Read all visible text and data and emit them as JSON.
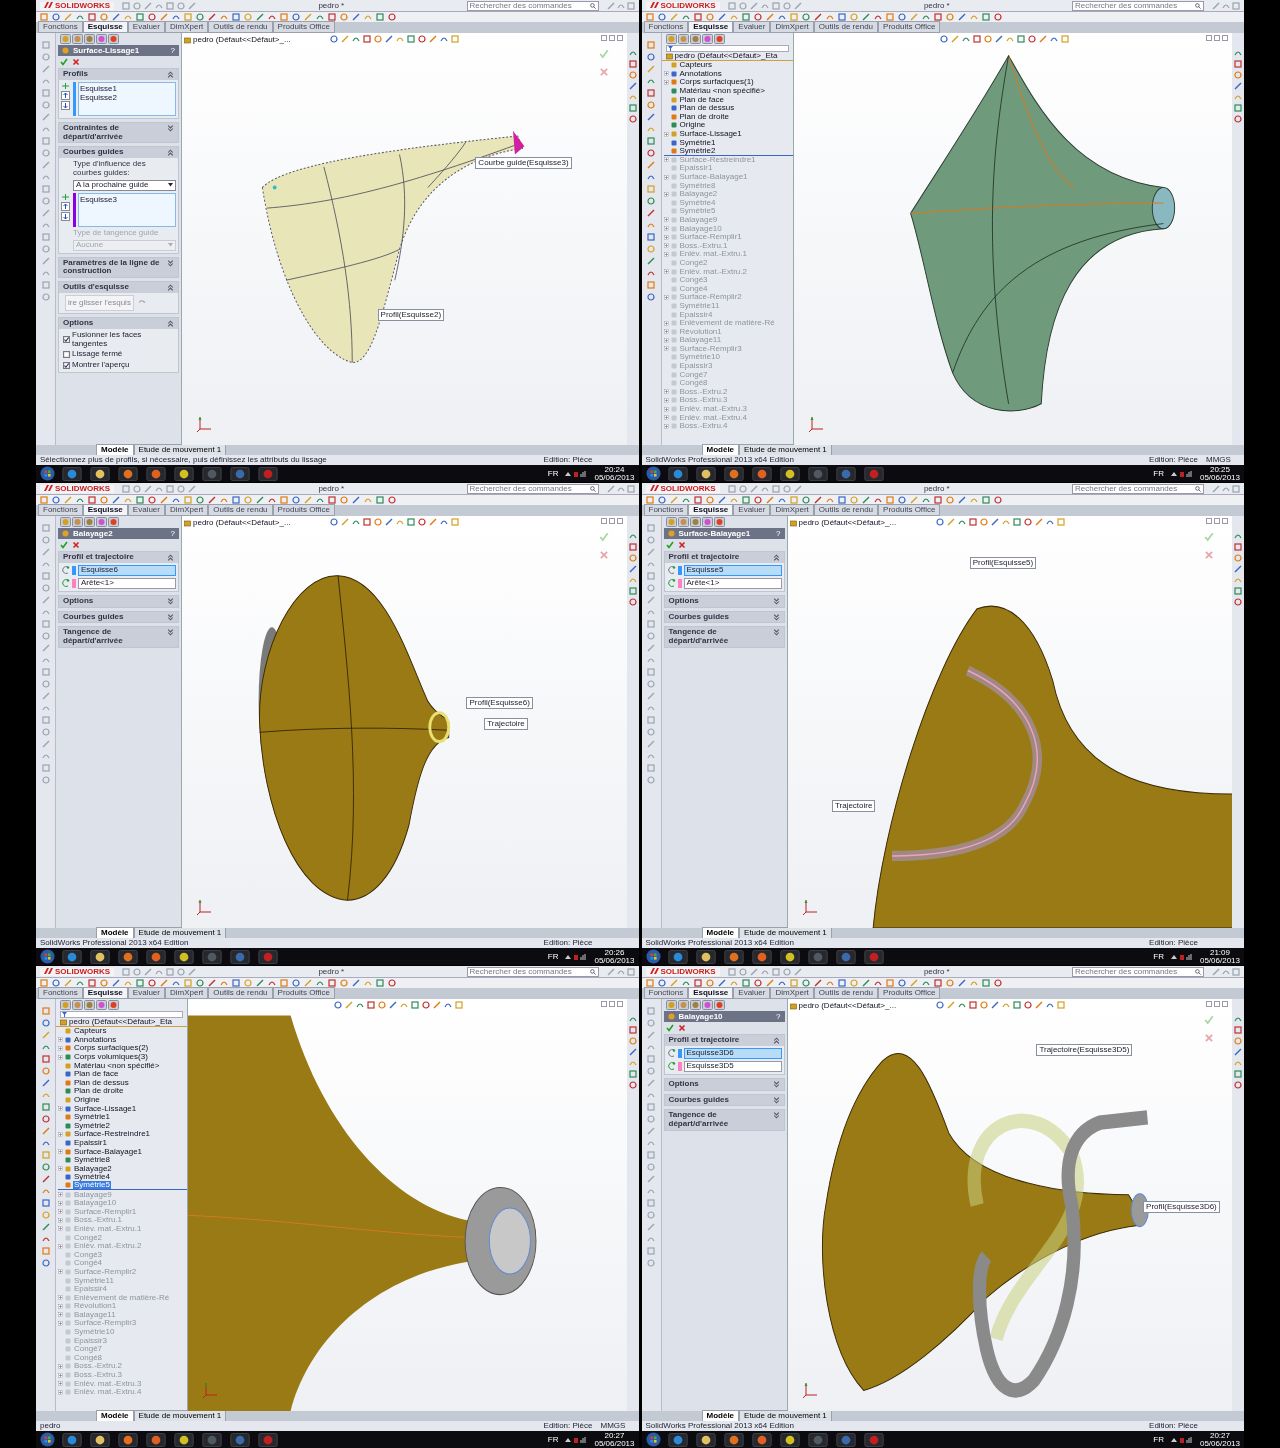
{
  "windows": [
    {
      "logo": "SOLIDWORKS",
      "title": "pedro *",
      "search_placeholder": "Rechercher des commandes",
      "tabs": [
        {
          "label": "Fonctions",
          "selected": false
        },
        {
          "label": "Esquisse",
          "selected": true
        },
        {
          "label": "Evaluer",
          "selected": false
        },
        {
          "label": "DimXpert",
          "selected": false
        },
        {
          "label": "Outils de rendu",
          "selected": false
        },
        {
          "label": "Produits Office",
          "selected": false
        }
      ],
      "panel": {
        "kind": "property",
        "title": "Surface-Lissage1",
        "help": "?",
        "sections": [
          {
            "title": "Profils",
            "expanded": true,
            "content": [
              {
                "kind": "list",
                "color": "#3399ff",
                "items": [
                  "Esquisse1",
                  "Esquisse2"
                ]
              }
            ]
          },
          {
            "title": "Contraintes de départ/d'arrivée",
            "expanded": false
          },
          {
            "title": "Courbes guides",
            "expanded": true,
            "content": [
              {
                "kind": "label",
                "text": "Type d'influence des courbes guides:",
                "disabled": false
              },
              {
                "kind": "select",
                "value": "A la prochaine guide",
                "disabled": false
              },
              {
                "kind": "list",
                "color": "#8a00e6",
                "items": [
                  "Esquisse3"
                ]
              },
              {
                "kind": "label",
                "text": "Type de tangence guide",
                "disabled": true
              },
              {
                "kind": "select",
                "value": "Aucune",
                "disabled": true
              }
            ]
          },
          {
            "title": "Paramètres de la ligne de construction",
            "expanded": false
          },
          {
            "title": "Outils d'esquisse",
            "expanded": true,
            "content": [
              {
                "kind": "button",
                "label": "ire glisser l'esquis"
              }
            ]
          },
          {
            "title": "Options",
            "expanded": true,
            "content": [
              {
                "kind": "checkbox",
                "label": "Fusionner les faces tangentes",
                "checked": true
              },
              {
                "kind": "checkbox",
                "label": "Lissage fermé",
                "checked": false
              },
              {
                "kind": "checkbox",
                "label": "Montrer l'aperçu",
                "checked": true
              }
            ]
          }
        ]
      },
      "model_header": "pedro  (Défaut<<Défaut>_...",
      "viewport": {
        "kind": "loft",
        "callouts": [
          "Courbe guide(Esquisse3)",
          "Profil(Esquisse2)"
        ]
      },
      "bottom_tabs": [
        {
          "label": "Modèle",
          "selected": true
        },
        {
          "label": "Etude de mouvement 1",
          "selected": false
        }
      ],
      "status_bar": {
        "message": "Sélectionnez plus de profils, si nécessaire, puis définissez les attributs du lissage",
        "mode": "Edition: Pièce"
      },
      "taskbar": {
        "language": "FR",
        "time": "20:24",
        "date": "05/06/2013"
      }
    },
    {
      "logo": "SOLIDWORKS",
      "title": "pedro *",
      "search_placeholder": "Rechercher des commandes",
      "tabs": [
        {
          "label": "Fonctions",
          "selected": false
        },
        {
          "label": "Esquisse",
          "selected": true
        },
        {
          "label": "Evaluer",
          "selected": false
        },
        {
          "label": "DimXpert",
          "selected": false
        },
        {
          "label": "Outils de rendu",
          "selected": false
        },
        {
          "label": "Produits Office",
          "selected": false
        }
      ],
      "panel": {
        "kind": "tree",
        "root": "pedro  (Défaut<<Défaut>_Eta",
        "items": [
          {
            "label": "Capteurs",
            "expandable": false,
            "rolled_back": false,
            "selected": false
          },
          {
            "label": "Annotations",
            "expandable": true,
            "rolled_back": false,
            "selected": false
          },
          {
            "label": "Corps surfaciques(1)",
            "expandable": true,
            "rolled_back": false,
            "selected": false
          },
          {
            "label": "Matériau <non spécifié>",
            "expandable": false,
            "rolled_back": false,
            "selected": false
          },
          {
            "label": "Plan de face",
            "expandable": false,
            "rolled_back": false,
            "selected": false
          },
          {
            "label": "Plan de dessus",
            "expandable": false,
            "rolled_back": false,
            "selected": false
          },
          {
            "label": "Plan de droite",
            "expandable": false,
            "rolled_back": false,
            "selected": false
          },
          {
            "label": "Origine",
            "expandable": false,
            "rolled_back": false,
            "selected": false
          },
          {
            "label": "Surface-Lissage1",
            "expandable": true,
            "rolled_back": false,
            "selected": false
          },
          {
            "label": "Symétrie1",
            "expandable": false,
            "rolled_back": false,
            "selected": false
          },
          {
            "label": "Symétrie2",
            "expandable": false,
            "rolled_back": false,
            "selected": false
          },
          {
            "label": "Surface-Restreindre1",
            "expandable": true,
            "rolled_back": true,
            "selected": false
          },
          {
            "label": "Epaissir1",
            "expandable": false,
            "rolled_back": true,
            "selected": false
          },
          {
            "label": "Surface-Balayage1",
            "expandable": true,
            "rolled_back": true,
            "selected": false
          },
          {
            "label": "Symétrie8",
            "expandable": false,
            "rolled_back": true,
            "selected": false
          },
          {
            "label": "Balayage2",
            "expandable": true,
            "rolled_back": true,
            "selected": false
          },
          {
            "label": "Symétrie4",
            "expandable": false,
            "rolled_back": true,
            "selected": false
          },
          {
            "label": "Symétrie5",
            "expandable": false,
            "rolled_back": true,
            "selected": false
          },
          {
            "label": "Balayage9",
            "expandable": true,
            "rolled_back": true,
            "selected": false
          },
          {
            "label": "Balayage10",
            "expandable": true,
            "rolled_back": true,
            "selected": false
          },
          {
            "label": "Surface-Remplir1",
            "expandable": true,
            "rolled_back": true,
            "selected": false
          },
          {
            "label": "Boss.-Extru.1",
            "expandable": true,
            "rolled_back": true,
            "selected": false
          },
          {
            "label": "Enlèv. mat.-Extru.1",
            "expandable": true,
            "rolled_back": true,
            "selected": false
          },
          {
            "label": "Congé2",
            "expandable": false,
            "rolled_back": true,
            "selected": false
          },
          {
            "label": "Enlèv. mat.-Extru.2",
            "expandable": true,
            "rolled_back": true,
            "selected": false
          },
          {
            "label": "Congé3",
            "expandable": false,
            "rolled_back": true,
            "selected": false
          },
          {
            "label": "Congé4",
            "expandable": false,
            "rolled_back": true,
            "selected": false
          },
          {
            "label": "Surface-Remplir2",
            "expandable": true,
            "rolled_back": true,
            "selected": false
          },
          {
            "label": "Symétrie11",
            "expandable": false,
            "rolled_back": true,
            "selected": false
          },
          {
            "label": "Epaissir4",
            "expandable": false,
            "rolled_back": true,
            "selected": false
          },
          {
            "label": "Enlèvement de matière-Ré",
            "expandable": true,
            "rolled_back": true,
            "selected": false
          },
          {
            "label": "Révolution1",
            "expandable": true,
            "rolled_back": true,
            "selected": false
          },
          {
            "label": "Balayage11",
            "expandable": true,
            "rolled_back": true,
            "selected": false
          },
          {
            "label": "Surface-Remplir3",
            "expandable": true,
            "rolled_back": true,
            "selected": false
          },
          {
            "label": "Symétrie10",
            "expandable": false,
            "rolled_back": true,
            "selected": false
          },
          {
            "label": "Epaissir3",
            "expandable": false,
            "rolled_back": true,
            "selected": false
          },
          {
            "label": "Congé7",
            "expandable": false,
            "rolled_back": true,
            "selected": false
          },
          {
            "label": "Congé8",
            "expandable": false,
            "rolled_back": true,
            "selected": false
          },
          {
            "label": "Boss.-Extru.2",
            "expandable": true,
            "rolled_back": true,
            "selected": false
          },
          {
            "label": "Boss.-Extru.3",
            "expandable": true,
            "rolled_back": true,
            "selected": false
          },
          {
            "label": "Enlèv. mat.-Extru.3",
            "expandable": true,
            "rolled_back": true,
            "selected": false
          },
          {
            "label": "Enlèv. mat.-Extru.4",
            "expandable": true,
            "rolled_back": true,
            "selected": false
          },
          {
            "label": "Boss.-Extru.4",
            "expandable": true,
            "rolled_back": true,
            "selected": false
          }
        ]
      },
      "viewport": {
        "kind": "smooth-horn"
      },
      "bottom_tabs": [
        {
          "label": "Modèle",
          "selected": true
        },
        {
          "label": "Etude de mouvement 1",
          "selected": false
        }
      ],
      "status_bar": {
        "message": "SolidWorks Professional 2013 x64 Edition",
        "mode": "Edition: Pièce",
        "units": "MMGS"
      },
      "taskbar": {
        "language": "FR",
        "time": "20:25",
        "date": "05/06/2013"
      }
    },
    {
      "logo": "SOLIDWORKS",
      "title": "pedro *",
      "search_placeholder": "Rechercher des commandes",
      "tabs": [
        {
          "label": "Fonctions",
          "selected": false
        },
        {
          "label": "Esquisse",
          "selected": true
        },
        {
          "label": "Evaluer",
          "selected": false
        },
        {
          "label": "DimXpert",
          "selected": false
        },
        {
          "label": "Outils de rendu",
          "selected": false
        },
        {
          "label": "Produits Office",
          "selected": false
        }
      ],
      "panel": {
        "kind": "property",
        "title": "Balayage2",
        "help": "?",
        "sections": [
          {
            "title": "Profil et trajectoire",
            "expanded": true,
            "content": [
              {
                "kind": "field",
                "value": "Esquisse6",
                "color": "#3399ff",
                "selected": true
              },
              {
                "kind": "field",
                "value": "Arête<1>",
                "color": "#ff80c0",
                "selected": false
              }
            ]
          },
          {
            "title": "Options",
            "expanded": false
          },
          {
            "title": "Courbes guides",
            "expanded": false
          },
          {
            "title": "Tangence de départ/d'arrivée",
            "expanded": false
          }
        ]
      },
      "model_header": "pedro  (Défaut<<Défaut>_...",
      "viewport": {
        "kind": "horn-front",
        "callouts": [
          "Profil(Esquisse6)",
          "Trajectoire"
        ]
      },
      "bottom_tabs": [
        {
          "label": "Modèle",
          "selected": true
        },
        {
          "label": "Etude de mouvement 1",
          "selected": false
        }
      ],
      "status_bar": {
        "message": "SolidWorks Professional 2013 x64 Edition",
        "mode": "Edition: Pièce"
      },
      "taskbar": {
        "language": "FR",
        "time": "20:26",
        "date": "05/06/2013"
      }
    },
    {
      "logo": "SOLIDWORKS",
      "title": "pedro *",
      "search_placeholder": "Rechercher des commandes",
      "tabs": [
        {
          "label": "Fonctions",
          "selected": false
        },
        {
          "label": "Esquisse",
          "selected": true
        },
        {
          "label": "Evaluer",
          "selected": false
        },
        {
          "label": "DimXpert",
          "selected": false
        },
        {
          "label": "Outils de rendu",
          "selected": false
        },
        {
          "label": "Produits Office",
          "selected": false
        }
      ],
      "panel": {
        "kind": "property",
        "title": "Surface-Balayage1",
        "help": "?",
        "sections": [
          {
            "title": "Profil et trajectoire",
            "expanded": true,
            "content": [
              {
                "kind": "field",
                "value": "Esquisse5",
                "color": "#3399ff",
                "selected": true
              },
              {
                "kind": "field",
                "value": "Arête<1>",
                "color": "#ff80c0",
                "selected": false
              }
            ]
          },
          {
            "title": "Options",
            "expanded": false
          },
          {
            "title": "Courbes guides",
            "expanded": false
          },
          {
            "title": "Tangence de départ/d'arrivée",
            "expanded": false
          }
        ]
      },
      "model_header": "pedro  (Défaut<<Défaut>_...",
      "viewport": {
        "kind": "horn-closeup",
        "callouts": [
          "Profil(Esquisse5)",
          "Trajectoire"
        ]
      },
      "bottom_tabs": [
        {
          "label": "Modèle",
          "selected": true
        },
        {
          "label": "Etude de mouvement 1",
          "selected": false
        }
      ],
      "status_bar": {
        "message": "SolidWorks Professional 2013 x64 Edition",
        "mode": "Edition: Pièce"
      },
      "taskbar": {
        "language": "FR",
        "time": "21:09",
        "date": "05/06/2013"
      }
    },
    {
      "logo": "SOLIDWORKS",
      "title": "pedro *",
      "search_placeholder": "Rechercher des commandes",
      "tabs": [
        {
          "label": "Fonctions",
          "selected": false
        },
        {
          "label": "Esquisse",
          "selected": true
        },
        {
          "label": "Evaluer",
          "selected": false
        },
        {
          "label": "DimXpert",
          "selected": false
        },
        {
          "label": "Outils de rendu",
          "selected": false
        },
        {
          "label": "Produits Office",
          "selected": false
        }
      ],
      "panel": {
        "kind": "tree",
        "root": "pedro  (Défaut<<Défaut>_Eta",
        "items": [
          {
            "label": "Capteurs",
            "expandable": false,
            "rolled_back": false,
            "selected": false
          },
          {
            "label": "Annotations",
            "expandable": true,
            "rolled_back": false,
            "selected": false
          },
          {
            "label": "Corps surfaciques(2)",
            "expandable": true,
            "rolled_back": false,
            "selected": false
          },
          {
            "label": "Corps volumiques(3)",
            "expandable": true,
            "rolled_back": false,
            "selected": false
          },
          {
            "label": "Matériau <non spécifié>",
            "expandable": false,
            "rolled_back": false,
            "selected": false
          },
          {
            "label": "Plan de face",
            "expandable": false,
            "rolled_back": false,
            "selected": false
          },
          {
            "label": "Plan de dessus",
            "expandable": false,
            "rolled_back": false,
            "selected": false
          },
          {
            "label": "Plan de droite",
            "expandable": false,
            "rolled_back": false,
            "selected": false
          },
          {
            "label": "Origine",
            "expandable": false,
            "rolled_back": false,
            "selected": false
          },
          {
            "label": "Surface-Lissage1",
            "expandable": true,
            "rolled_back": false,
            "selected": false
          },
          {
            "label": "Symétrie1",
            "expandable": false,
            "rolled_back": false,
            "selected": false
          },
          {
            "label": "Symétrie2",
            "expandable": false,
            "rolled_back": false,
            "selected": false
          },
          {
            "label": "Surface-Restreindre1",
            "expandable": true,
            "rolled_back": false,
            "selected": false
          },
          {
            "label": "Epaissir1",
            "expandable": false,
            "rolled_back": false,
            "selected": false
          },
          {
            "label": "Surface-Balayage1",
            "expandable": true,
            "rolled_back": false,
            "selected": false
          },
          {
            "label": "Symétrie8",
            "expandable": false,
            "rolled_back": false,
            "selected": false
          },
          {
            "label": "Balayage2",
            "expandable": true,
            "rolled_back": false,
            "selected": false
          },
          {
            "label": "Symétrie4",
            "expandable": false,
            "rolled_back": false,
            "selected": false
          },
          {
            "label": "Symétrie5",
            "expandable": false,
            "rolled_back": false,
            "selected": true
          },
          {
            "label": "Balayage9",
            "expandable": true,
            "rolled_back": true,
            "selected": false
          },
          {
            "label": "Balayage10",
            "expandable": true,
            "rolled_back": true,
            "selected": false
          },
          {
            "label": "Surface-Remplir1",
            "expandable": true,
            "rolled_back": true,
            "selected": false
          },
          {
            "label": "Boss.-Extru.1",
            "expandable": true,
            "rolled_back": true,
            "selected": false
          },
          {
            "label": "Enlèv. mat.-Extru.1",
            "expandable": true,
            "rolled_back": true,
            "selected": false
          },
          {
            "label": "Congé2",
            "expandable": false,
            "rolled_back": true,
            "selected": false
          },
          {
            "label": "Enlèv. mat.-Extru.2",
            "expandable": true,
            "rolled_back": true,
            "selected": false
          },
          {
            "label": "Congé3",
            "expandable": false,
            "rolled_back": true,
            "selected": false
          },
          {
            "label": "Congé4",
            "expandable": false,
            "rolled_back": true,
            "selected": false
          },
          {
            "label": "Surface-Remplir2",
            "expandable": true,
            "rolled_back": true,
            "selected": false
          },
          {
            "label": "Symétrie11",
            "expandable": false,
            "rolled_back": true,
            "selected": false
          },
          {
            "label": "Epaissir4",
            "expandable": false,
            "rolled_back": true,
            "selected": false
          },
          {
            "label": "Enlèvement de matière-Ré",
            "expandable": true,
            "rolled_back": true,
            "selected": false
          },
          {
            "label": "Révolution1",
            "expandable": true,
            "rolled_back": true,
            "selected": false
          },
          {
            "label": "Balayage11",
            "expandable": true,
            "rolled_back": true,
            "selected": false
          },
          {
            "label": "Surface-Remplir3",
            "expandable": true,
            "rolled_back": true,
            "selected": false
          },
          {
            "label": "Symétrie10",
            "expandable": false,
            "rolled_back": true,
            "selected": false
          },
          {
            "label": "Epaissir3",
            "expandable": false,
            "rolled_back": true,
            "selected": false
          },
          {
            "label": "Congé7",
            "expandable": false,
            "rolled_back": true,
            "selected": false
          },
          {
            "label": "Congé8",
            "expandable": false,
            "rolled_back": true,
            "selected": false
          },
          {
            "label": "Boss.-Extru.2",
            "expandable": true,
            "rolled_back": true,
            "selected": false
          },
          {
            "label": "Boss.-Extru.3",
            "expandable": true,
            "rolled_back": true,
            "selected": false
          },
          {
            "label": "Enlèv. mat.-Extru.3",
            "expandable": true,
            "rolled_back": true,
            "selected": false
          },
          {
            "label": "Enlèv. mat.-Extru.4",
            "expandable": true,
            "rolled_back": true,
            "selected": false
          }
        ]
      },
      "viewport": {
        "kind": "horn-side"
      },
      "bottom_tabs": [
        {
          "label": "Modèle",
          "selected": true
        },
        {
          "label": "Etude de mouvement 1",
          "selected": false
        }
      ],
      "status_bar": {
        "message": "pedro",
        "mode": "Edition: Pièce",
        "units": "MMGS"
      },
      "taskbar": {
        "language": "FR",
        "time": "20:27",
        "date": "05/06/2013"
      }
    },
    {
      "logo": "SOLIDWORKS",
      "title": "pedro *",
      "search_placeholder": "Rechercher des commandes",
      "tabs": [
        {
          "label": "Fonctions",
          "selected": false
        },
        {
          "label": "Esquisse",
          "selected": true
        },
        {
          "label": "Evaluer",
          "selected": false
        },
        {
          "label": "DimXpert",
          "selected": false
        },
        {
          "label": "Outils de rendu",
          "selected": false
        },
        {
          "label": "Produits Office",
          "selected": false
        }
      ],
      "panel": {
        "kind": "property",
        "title": "Balayage10",
        "help": "?",
        "sections": [
          {
            "title": "Profil et trajectoire",
            "expanded": true,
            "content": [
              {
                "kind": "field",
                "value": "Esquisse3D6",
                "color": "#3399ff",
                "selected": true
              },
              {
                "kind": "field",
                "value": "Esquisse3D5",
                "color": "#ff80c0",
                "selected": false
              }
            ]
          },
          {
            "title": "Options",
            "expanded": false
          },
          {
            "title": "Courbes guides",
            "expanded": false
          },
          {
            "title": "Tangence de départ/d'arrivée",
            "expanded": false
          }
        ]
      },
      "model_header": "pedro  (Défaut<<Défaut>_...",
      "viewport": {
        "kind": "horn-pipe",
        "callouts": [
          "Trajectoire(Esquisse3D5)",
          "Profil(Esquisse3D6)"
        ]
      },
      "bottom_tabs": [
        {
          "label": "Modèle",
          "selected": true
        },
        {
          "label": "Etude de mouvement 1",
          "selected": false
        }
      ],
      "status_bar": {
        "message": "SolidWorks Professional 2013 x64 Edition",
        "mode": "Edition: Pièce"
      },
      "taskbar": {
        "language": "FR",
        "time": "20:27",
        "date": "05/06/2013"
      }
    }
  ]
}
